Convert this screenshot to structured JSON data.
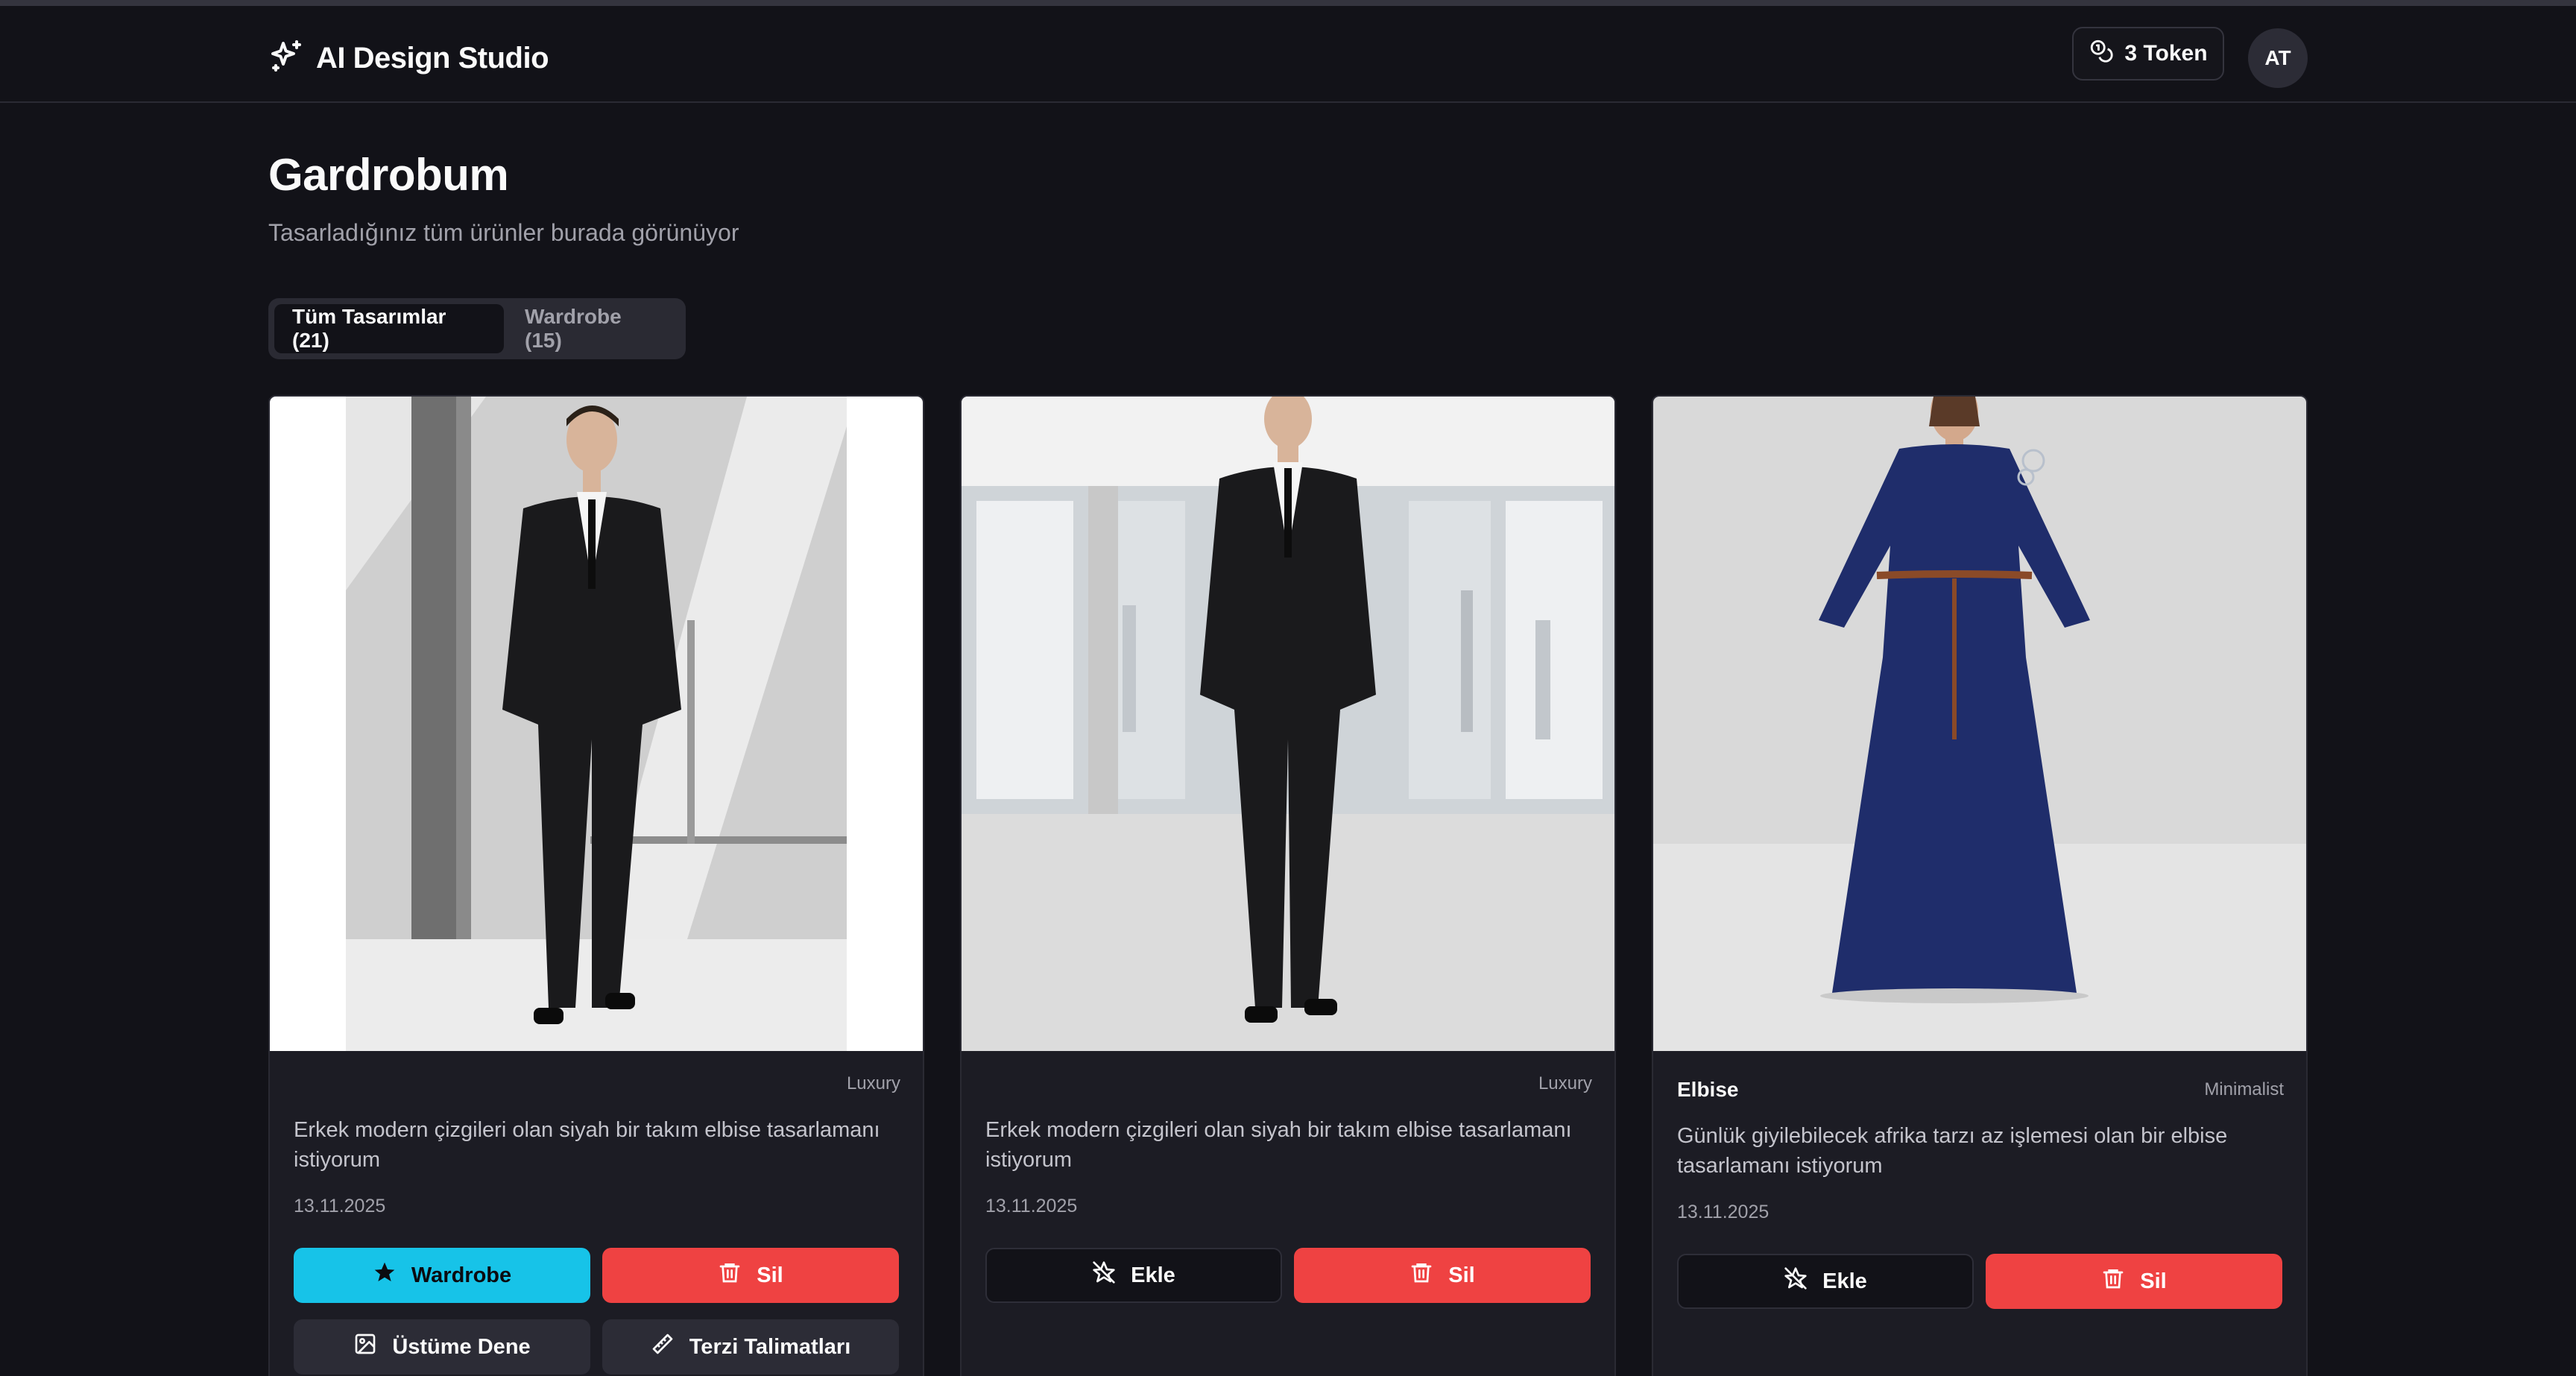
{
  "app": {
    "title": "AI Design Studio",
    "icon": "sparkles-icon"
  },
  "header": {
    "token_label": "3 Token",
    "token_icon": "coins-icon",
    "avatar_initials": "AT"
  },
  "page": {
    "title": "Gardrobum",
    "subtitle": "Tasarladığınız tüm ürünler burada görünüyor"
  },
  "tabs": [
    {
      "label": "Tüm Tasarımlar (21)",
      "active": true
    },
    {
      "label": "Wardrobe (15)",
      "active": false
    }
  ],
  "cards": [
    {
      "name": "",
      "style": "Luxury",
      "description": "Erkek modern çizgileri olan siyah bir takım elbise tasarlamanı istiyorum",
      "date": "13.11.2025",
      "primary_label": "Wardrobe",
      "delete_label": "Sil",
      "try_on_label": "Üstüme Dene",
      "tailor_label": "Terzi Talimatları"
    },
    {
      "name": "",
      "style": "Luxury",
      "description": "Erkek modern çizgileri olan siyah bir takım elbise tasarlamanı istiyorum",
      "date": "13.11.2025",
      "primary_label": "Ekle",
      "delete_label": "Sil"
    },
    {
      "name": "Elbise",
      "style": "Minimalist",
      "description": "Günlük giyilebilecek afrika tarzı az işlemesi olan bir elbise tasarlamanı istiyorum",
      "date": "13.11.2025",
      "primary_label": "Ekle",
      "delete_label": "Sil"
    }
  ],
  "colors": {
    "background": "#121218",
    "card": "#1c1c24",
    "accent_cyan": "#17c3e8",
    "danger_red": "#ef4242"
  }
}
